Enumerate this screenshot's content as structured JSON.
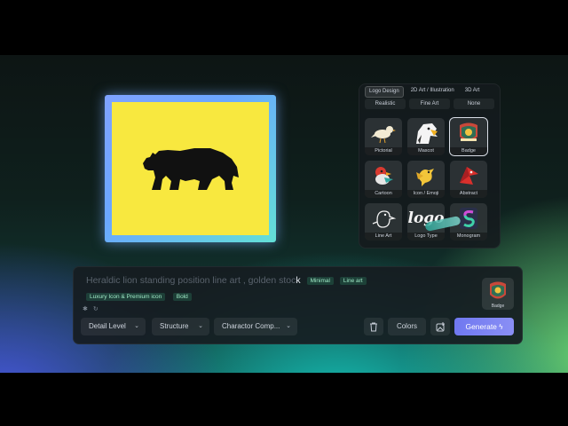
{
  "style_panel": {
    "tabs": [
      {
        "label": "Logo Design",
        "active": true
      },
      {
        "label": "2D Art / Illustration",
        "active": false
      },
      {
        "label": "3D Art",
        "active": false
      }
    ],
    "subtabs": [
      "Realistic",
      "Fine Art",
      "None"
    ],
    "tiles": [
      {
        "label": "Pictorial",
        "icon": "bird-pictorial-icon"
      },
      {
        "label": "Mascot",
        "icon": "eagle-mascot-icon"
      },
      {
        "label": "Badge",
        "icon": "badge-emblem-icon"
      },
      {
        "label": "Cartoon",
        "icon": "cartoon-bird-icon"
      },
      {
        "label": "Icon / Emoji",
        "icon": "yellow-bird-icon"
      },
      {
        "label": "Abstract",
        "icon": "abstract-bird-icon"
      },
      {
        "label": "Line Art",
        "icon": "line-art-bird-icon"
      },
      {
        "label": "Logo Type",
        "icon": "logotype-icon"
      },
      {
        "label": "Monogram",
        "icon": "monogram-s-icon"
      }
    ],
    "logotype_text": "logo"
  },
  "preview": {
    "image": "bear-silhouette-icon",
    "background": "#f8e83f"
  },
  "prompt": {
    "text": "Heraldic lion standing position line art , golden stoc",
    "cursor_char": "k",
    "chips_inline": [
      "Minimal",
      "Line art"
    ],
    "chips_second": [
      "Luxury Icon & Premium icon",
      "Bold"
    ],
    "dropdowns": [
      "Detail Level",
      "Structure",
      "Charactor Comp..."
    ],
    "colors_label": "Colors",
    "generate_label": "Generate",
    "selected_style": "Badge"
  }
}
